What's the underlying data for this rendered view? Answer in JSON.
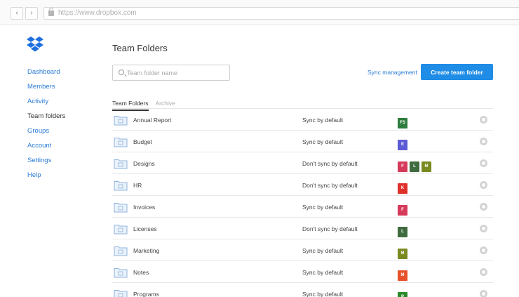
{
  "browser": {
    "url": "https://www.dropbox.com",
    "back_glyph": "‹",
    "forward_glyph": "›"
  },
  "sidebar": {
    "items": [
      {
        "label": "Dashboard",
        "active": false
      },
      {
        "label": "Members",
        "active": false
      },
      {
        "label": "Activity",
        "active": false
      },
      {
        "label": "Team folders",
        "active": true
      },
      {
        "label": "Groups",
        "active": false
      },
      {
        "label": "Account",
        "active": false
      },
      {
        "label": "Settings",
        "active": false
      },
      {
        "label": "Help",
        "active": false
      }
    ]
  },
  "header": {
    "title": "Team Folders",
    "search_placeholder": "Team folder name",
    "sync_management": "Sync management",
    "create_button": "Create team folder"
  },
  "tabs": [
    {
      "label": "Team Folders",
      "active": true
    },
    {
      "label": "Archive",
      "active": false
    }
  ],
  "rows": [
    {
      "name": "Annual Report",
      "sync": "Sync by default",
      "members": [
        {
          "initials": "FS",
          "color": "#2e7d3e"
        }
      ]
    },
    {
      "name": "Budget",
      "sync": "Sync by default",
      "members": [
        {
          "initials": "E",
          "color": "#5b5bd6"
        }
      ]
    },
    {
      "name": "Designs",
      "sync": "Don't sync by default",
      "members": [
        {
          "initials": "F",
          "color": "#d63a5a"
        },
        {
          "initials": "L",
          "color": "#3f6b3f"
        },
        {
          "initials": "M",
          "color": "#7a8a1f"
        }
      ]
    },
    {
      "name": "HR",
      "sync": "Don't sync by default",
      "members": [
        {
          "initials": "K",
          "color": "#e0302a"
        }
      ]
    },
    {
      "name": "Invoices",
      "sync": "Sync by default",
      "members": [
        {
          "initials": "F",
          "color": "#d63a5a"
        }
      ]
    },
    {
      "name": "Licenses",
      "sync": "Don't sync by default",
      "members": [
        {
          "initials": "L",
          "color": "#3f6b3f"
        }
      ]
    },
    {
      "name": "Marketing",
      "sync": "Sync by default",
      "members": [
        {
          "initials": "M",
          "color": "#7a8a1f"
        }
      ]
    },
    {
      "name": "Notes",
      "sync": "Sync by default",
      "members": [
        {
          "initials": "M",
          "color": "#e8502a"
        }
      ]
    },
    {
      "name": "Programs",
      "sync": "Sync by default",
      "members": [
        {
          "initials": "P",
          "color": "#2a8a2a"
        }
      ]
    }
  ],
  "colors": {
    "accent": "#1f8ce6",
    "link": "#2b7bd6",
    "logo": "#1f6fe0",
    "folder": "#8fb3dc"
  }
}
